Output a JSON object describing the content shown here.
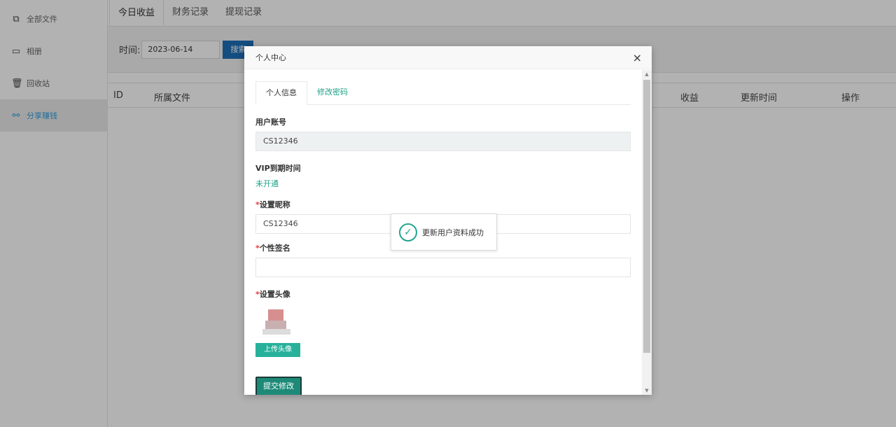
{
  "sidebar": {
    "items": [
      {
        "icon": "copy-icon",
        "glyph": "⧉",
        "label": "全部文件"
      },
      {
        "icon": "monitor-icon",
        "glyph": "▭",
        "label": "相册"
      },
      {
        "icon": "trash-icon",
        "glyph": "🗑",
        "label": "回收站"
      },
      {
        "icon": "share-icon",
        "glyph": "⚯",
        "label": "分享赚钱",
        "active": true
      }
    ]
  },
  "tabs": [
    "今日收益",
    "财务记录",
    "提现记录"
  ],
  "filter": {
    "label": "时间:",
    "date": "2023-06-14",
    "search": "搜索"
  },
  "table": {
    "headers": [
      "ID",
      "所属文件",
      "收益",
      "更新时间",
      "操作"
    ]
  },
  "modal": {
    "title": "个人中心",
    "close": "×",
    "tabs": [
      "个人信息",
      "修改密码"
    ],
    "account": {
      "label": "用户账号",
      "value": "CS12346"
    },
    "vip": {
      "label": "VIP到期时间",
      "value": "未开通"
    },
    "nickname": {
      "label": "设置昵称",
      "value": "CS12346"
    },
    "signature": {
      "label": "个性签名",
      "value": ""
    },
    "avatar": {
      "label": "设置头像",
      "upload": "上传头像"
    },
    "submit": "提交修改",
    "required_mark": "*"
  },
  "toast": {
    "message": "更新用户资料成功"
  },
  "colors": {
    "accent": "#1fa38a",
    "link_blue": "#2f9de0",
    "button_blue": "#1e6fb8"
  }
}
